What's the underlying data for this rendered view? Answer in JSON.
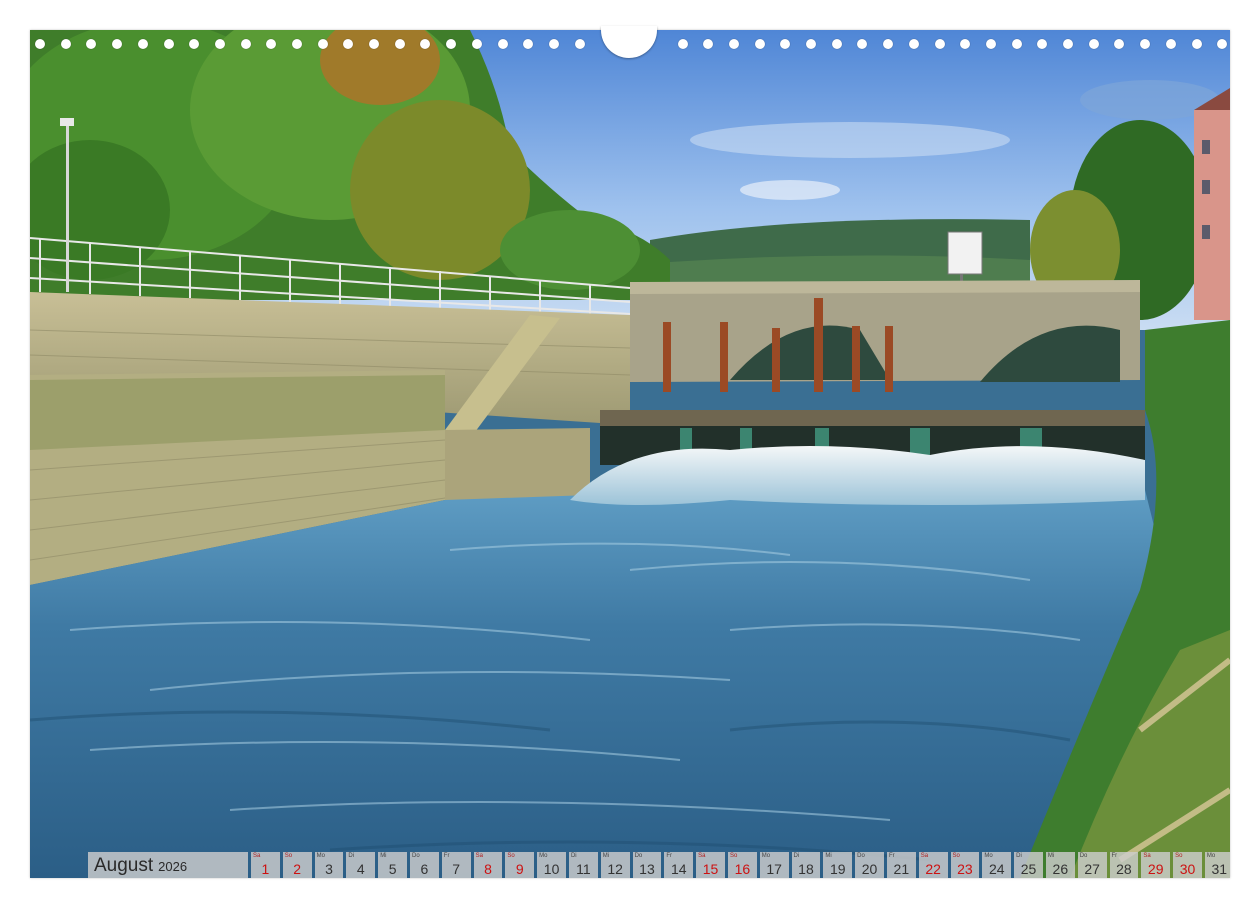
{
  "calendar": {
    "month": "August",
    "year": "2026",
    "days": [
      {
        "wd": "Sa",
        "num": "1",
        "weekend": true
      },
      {
        "wd": "So",
        "num": "2",
        "weekend": true
      },
      {
        "wd": "Mo",
        "num": "3",
        "weekend": false
      },
      {
        "wd": "Di",
        "num": "4",
        "weekend": false
      },
      {
        "wd": "Mi",
        "num": "5",
        "weekend": false
      },
      {
        "wd": "Do",
        "num": "6",
        "weekend": false
      },
      {
        "wd": "Fr",
        "num": "7",
        "weekend": false
      },
      {
        "wd": "Sa",
        "num": "8",
        "weekend": true
      },
      {
        "wd": "So",
        "num": "9",
        "weekend": true
      },
      {
        "wd": "Mo",
        "num": "10",
        "weekend": false
      },
      {
        "wd": "Di",
        "num": "11",
        "weekend": false
      },
      {
        "wd": "Mi",
        "num": "12",
        "weekend": false
      },
      {
        "wd": "Do",
        "num": "13",
        "weekend": false
      },
      {
        "wd": "Fr",
        "num": "14",
        "weekend": false
      },
      {
        "wd": "Sa",
        "num": "15",
        "weekend": true
      },
      {
        "wd": "So",
        "num": "16",
        "weekend": true
      },
      {
        "wd": "Mo",
        "num": "17",
        "weekend": false
      },
      {
        "wd": "Di",
        "num": "18",
        "weekend": false
      },
      {
        "wd": "Mi",
        "num": "19",
        "weekend": false
      },
      {
        "wd": "Do",
        "num": "20",
        "weekend": false
      },
      {
        "wd": "Fr",
        "num": "21",
        "weekend": false
      },
      {
        "wd": "Sa",
        "num": "22",
        "weekend": true
      },
      {
        "wd": "So",
        "num": "23",
        "weekend": true
      },
      {
        "wd": "Mo",
        "num": "24",
        "weekend": false
      },
      {
        "wd": "Di",
        "num": "25",
        "weekend": false
      },
      {
        "wd": "Mi",
        "num": "26",
        "weekend": false
      },
      {
        "wd": "Do",
        "num": "27",
        "weekend": false
      },
      {
        "wd": "Fr",
        "num": "28",
        "weekend": false
      },
      {
        "wd": "Sa",
        "num": "29",
        "weekend": true
      },
      {
        "wd": "So",
        "num": "30",
        "weekend": true
      },
      {
        "wd": "Mo",
        "num": "31",
        "weekend": false
      }
    ]
  },
  "colors": {
    "weekend_text": "#cc1212",
    "weekday_text": "#333333",
    "cell_background": "#cdcdcd"
  }
}
